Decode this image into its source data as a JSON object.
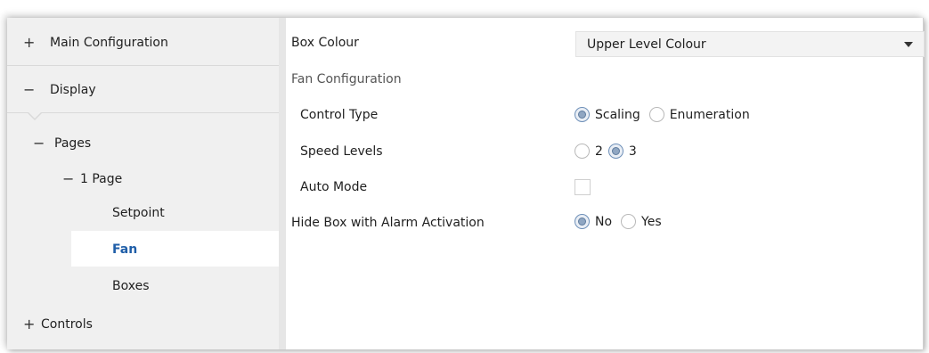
{
  "sidebar": {
    "main_configuration": {
      "toggle": "+",
      "label": "Main Configuration"
    },
    "display": {
      "toggle": "−",
      "label": "Display"
    },
    "pages": {
      "toggle": "−",
      "label": "Pages"
    },
    "page_1": {
      "toggle": "−",
      "label": "1 Page"
    },
    "setpoint": {
      "label": "Setpoint"
    },
    "fan": {
      "label": "Fan"
    },
    "boxes": {
      "label": "Boxes"
    },
    "controls": {
      "toggle": "+",
      "label": "Controls"
    }
  },
  "main": {
    "box_colour": {
      "label": "Box Colour",
      "value": "Upper Level Colour"
    },
    "fan_configuration": {
      "label": "Fan Configuration"
    },
    "control_type": {
      "label": "Control Type",
      "options": [
        "Scaling",
        "Enumeration"
      ],
      "selected": "Scaling"
    },
    "speed_levels": {
      "label": "Speed Levels",
      "options": [
        "2",
        "3"
      ],
      "selected": "3"
    },
    "auto_mode": {
      "label": "Auto Mode",
      "checked": false
    },
    "hide_box": {
      "label": "Hide Box with Alarm Activation",
      "options": [
        "No",
        "Yes"
      ],
      "selected": "No"
    }
  },
  "colors": {
    "selected_nav_text": "#1f5ea8",
    "sidebar_bg": "#f0f0f0",
    "radio_checked": "#8fa6c2"
  }
}
